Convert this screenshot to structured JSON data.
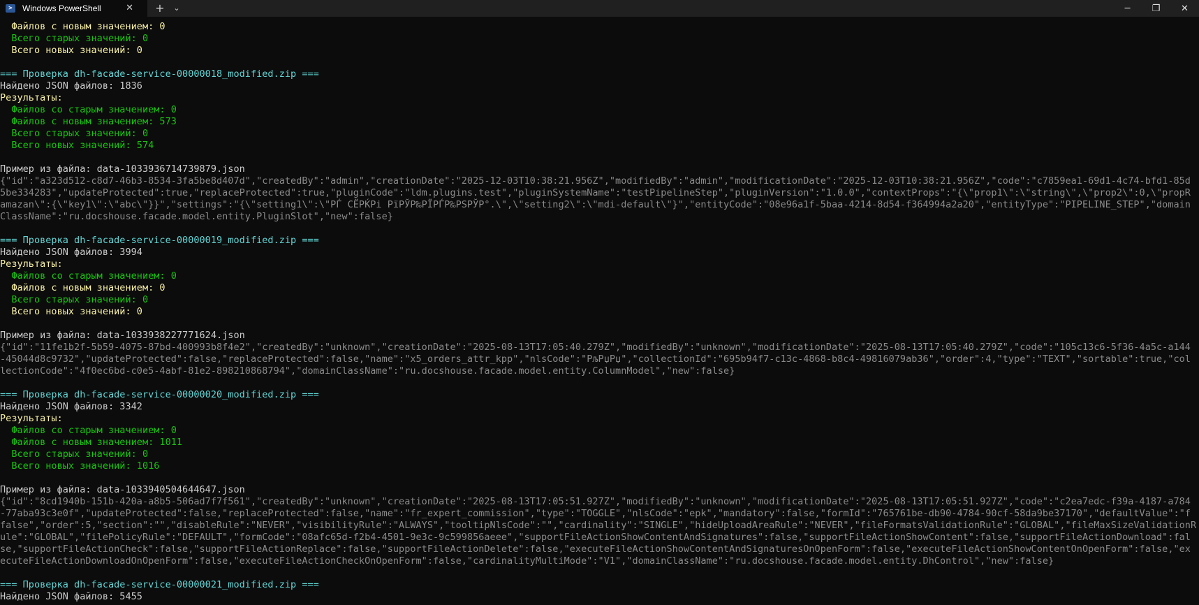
{
  "window": {
    "tab_title": "Windows PowerShell",
    "tab_icon": "powershell-icon",
    "close_tab_glyph": "✕",
    "new_tab_glyph": "+",
    "dropdown_glyph": "⌄",
    "minimize_glyph": "─",
    "maximize_glyph": "❐",
    "close_glyph": "✕"
  },
  "colors": {
    "background": "#0c0c0c",
    "titlebar": "#202020",
    "white": "#cccccc",
    "yellow": "#f9f1a5",
    "green": "#16c60c",
    "cyan": "#61d6d6",
    "gray": "#8a8a8a"
  },
  "terminal_lines": [
    {
      "text": "  Файлов с новым значением: 0",
      "color": "yellow"
    },
    {
      "text": "  Всего старых значений: 0",
      "color": "green"
    },
    {
      "text": "  Всего новых значений: 0",
      "color": "yellow"
    },
    {
      "text": "",
      "color": "white"
    },
    {
      "text": "=== Проверка dh-facade-service-00000018_modified.zip ===",
      "color": "cyan"
    },
    {
      "text": "Найдено JSON файлов: 1836",
      "color": "white"
    },
    {
      "text": "Результаты:",
      "color": "yellow"
    },
    {
      "text": "  Файлов со старым значением: 0",
      "color": "green"
    },
    {
      "text": "  Файлов с новым значением: 573",
      "color": "green"
    },
    {
      "text": "  Всего старых значений: 0",
      "color": "green"
    },
    {
      "text": "  Всего новых значений: 574",
      "color": "green"
    },
    {
      "text": "",
      "color": "white"
    },
    {
      "text": "Пример из файла: data-1033936714739879.json",
      "color": "white"
    },
    {
      "text": "{\"id\":\"a323d512-c8d7-46b3-8534-3fa5be8d407d\",\"createdBy\":\"admin\",\"creationDate\":\"2025-12-03T10:38:21.956Z\",\"modifiedBy\":\"admin\",\"modificationDate\":\"2025-12-03T10:38:21.956Z\",\"code\":\"c7859ea1-69d1-4c74-bfd1-85d",
      "color": "gray"
    },
    {
      "text": "5be334283\",\"updateProtected\":true,\"replaceProtected\":true,\"pluginCode\":\"ldm.plugins.test\",\"pluginSystemName\":\"testPipelineStep\",\"pluginVersion\":\"1.0.0\",\"contextProps\":\"{\\\"prop1\\\":\\\"string\\\",\\\"prop2\\\":0,\\\"propR",
      "color": "gray"
    },
    {
      "text": "amazan\\\":{\\\"key1\\\":\\\"abc\\\"}}\",\"settings\":\"{\\\"setting1\\\":\\\"РЃ СЁРЌРі РїРЎР‰РЇРЃР‰РЅРЎР°.\\\",\\\"setting2\\\":\\\"mdi-default\\\"}\",\"entityCode\":\"08e96a1f-5baa-4214-8d54-f364994a2a20\",\"entityType\":\"PIPELINE_STEP\",\"domain",
      "color": "gray"
    },
    {
      "text": "ClassName\":\"ru.docshouse.facade.model.entity.PluginSlot\",\"new\":false}",
      "color": "gray"
    },
    {
      "text": "",
      "color": "white"
    },
    {
      "text": "=== Проверка dh-facade-service-00000019_modified.zip ===",
      "color": "cyan"
    },
    {
      "text": "Найдено JSON файлов: 3994",
      "color": "white"
    },
    {
      "text": "Результаты:",
      "color": "yellow"
    },
    {
      "text": "  Файлов со старым значением: 0",
      "color": "green"
    },
    {
      "text": "  Файлов с новым значением: 0",
      "color": "yellow"
    },
    {
      "text": "  Всего старых значений: 0",
      "color": "green"
    },
    {
      "text": "  Всего новых значений: 0",
      "color": "yellow"
    },
    {
      "text": "",
      "color": "white"
    },
    {
      "text": "Пример из файла: data-1033938227771624.json",
      "color": "white"
    },
    {
      "text": "{\"id\":\"11fe1b2f-5b59-4075-87bd-400993b8f4e2\",\"createdBy\":\"unknown\",\"creationDate\":\"2025-08-13T17:05:40.279Z\",\"modifiedBy\":\"unknown\",\"modificationDate\":\"2025-08-13T17:05:40.279Z\",\"code\":\"105c13c6-5f36-4a5c-a144",
      "color": "gray"
    },
    {
      "text": "-45044d8c9732\",\"updateProtected\":false,\"replaceProtected\":false,\"name\":\"x5_orders_attr_kpp\",\"nlsCode\":\"РљРџРџ\",\"collectionId\":\"695b94f7-c13c-4868-b8c4-49816079ab36\",\"order\":4,\"type\":\"TEXT\",\"sortable\":true,\"col",
      "color": "gray"
    },
    {
      "text": "lectionCode\":\"4f0ec6bd-c0e5-4abf-81e2-898210868794\",\"domainClassName\":\"ru.docshouse.facade.model.entity.ColumnModel\",\"new\":false}",
      "color": "gray"
    },
    {
      "text": "",
      "color": "white"
    },
    {
      "text": "=== Проверка dh-facade-service-00000020_modified.zip ===",
      "color": "cyan"
    },
    {
      "text": "Найдено JSON файлов: 3342",
      "color": "white"
    },
    {
      "text": "Результаты:",
      "color": "yellow"
    },
    {
      "text": "  Файлов со старым значением: 0",
      "color": "green"
    },
    {
      "text": "  Файлов с новым значением: 1011",
      "color": "green"
    },
    {
      "text": "  Всего старых значений: 0",
      "color": "green"
    },
    {
      "text": "  Всего новых значений: 1016",
      "color": "green"
    },
    {
      "text": "",
      "color": "white"
    },
    {
      "text": "Пример из файла: data-1033940504644647.json",
      "color": "white"
    },
    {
      "text": "{\"id\":\"8cd1940b-151b-420a-a8b5-506ad7f7f561\",\"createdBy\":\"unknown\",\"creationDate\":\"2025-08-13T17:05:51.927Z\",\"modifiedBy\":\"unknown\",\"modificationDate\":\"2025-08-13T17:05:51.927Z\",\"code\":\"c2ea7edc-f39a-4187-a784",
      "color": "gray"
    },
    {
      "text": "-77aba93c3e0f\",\"updateProtected\":false,\"replaceProtected\":false,\"name\":\"fr_expert_commission\",\"type\":\"TOGGLE\",\"nlsCode\":\"epk\",\"mandatory\":false,\"formId\":\"765761be-db90-4784-90cf-58da9be37170\",\"defaultValue\":\"f",
      "color": "gray"
    },
    {
      "text": "false\",\"order\":5,\"section\":\"\",\"disableRule\":\"NEVER\",\"visibilityRule\":\"ALWAYS\",\"tooltipNlsCode\":\"\",\"cardinality\":\"SINGLE\",\"hideUploadAreaRule\":\"NEVER\",\"fileFormatsValidationRule\":\"GLOBAL\",\"fileMaxSizeValidationR",
      "color": "gray"
    },
    {
      "text": "ule\":\"GLOBAL\",\"filePolicyRule\":\"DEFAULT\",\"formCode\":\"08afc65d-f2b4-4501-9e3c-9c599856aeee\",\"supportFileActionShowContentAndSignatures\":false,\"supportFileActionShowContent\":false,\"supportFileActionDownload\":fal",
      "color": "gray"
    },
    {
      "text": "se,\"supportFileActionCheck\":false,\"supportFileActionReplace\":false,\"supportFileActionDelete\":false,\"executeFileActionShowContentAndSignaturesOnOpenForm\":false,\"executeFileActionShowContentOnOpenForm\":false,\"ex",
      "color": "gray"
    },
    {
      "text": "ecuteFileActionDownloadOnOpenForm\":false,\"executeFileActionCheckOnOpenForm\":false,\"cardinalityMultiMode\":\"V1\",\"domainClassName\":\"ru.docshouse.facade.model.entity.DhControl\",\"new\":false}",
      "color": "gray"
    },
    {
      "text": "",
      "color": "white"
    },
    {
      "text": "=== Проверка dh-facade-service-00000021_modified.zip ===",
      "color": "cyan"
    },
    {
      "text": "Найдено JSON файлов: 5455",
      "color": "white"
    }
  ]
}
